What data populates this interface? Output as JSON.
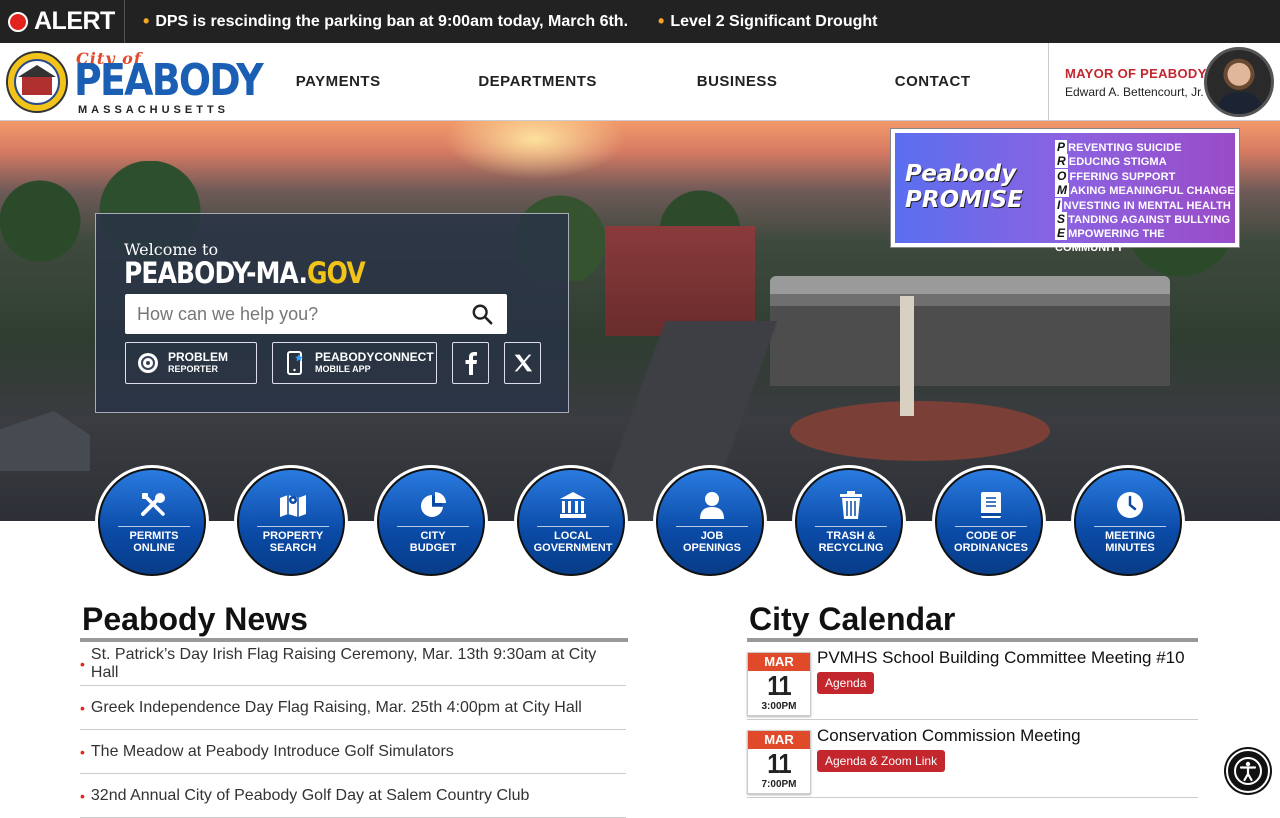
{
  "alert": {
    "label": "ALERT",
    "items": [
      "DPS is rescinding the parking ban at 9:00am today, March 6th.",
      "Level 2 Significant Drought"
    ]
  },
  "logo": {
    "city": "City of",
    "name": "PEABODY",
    "state": "MASSACHUSETTS"
  },
  "nav": {
    "items": [
      "PAYMENTS",
      "DEPARTMENTS",
      "BUSINESS",
      "CONTACT"
    ]
  },
  "mayor": {
    "title": "MAYOR OF PEABODY",
    "name": "Edward A. Bettencourt, Jr."
  },
  "welcome": {
    "to": "Welcome to",
    "site_main": "PEABODY-MA.",
    "site_accent": "GOV",
    "search_placeholder": "How can we help you?",
    "problem_line1": "PROBLEM",
    "problem_line2": "REPORTER",
    "connect_line1": "PEABODYCONNECT",
    "connect_line2": "MOBILE APP"
  },
  "promise": {
    "title1": "Peabody",
    "title2": "PROMISE",
    "lines": [
      {
        "letter": "P",
        "rest": "REVENTING SUICIDE"
      },
      {
        "letter": "R",
        "rest": "EDUCING STIGMA"
      },
      {
        "letter": "O",
        "rest": "FFERING SUPPORT"
      },
      {
        "letter": "M",
        "rest": "AKING MEANINGFUL CHANGE"
      },
      {
        "letter": "I",
        "rest": "NVESTING IN MENTAL HEALTH"
      },
      {
        "letter": "S",
        "rest": "TANDING AGAINST BULLYING"
      },
      {
        "letter": "E",
        "rest": "MPOWERING THE COMMUNITY"
      }
    ]
  },
  "quick_links": [
    {
      "l1": "PERMITS",
      "l2": "ONLINE",
      "icon": "tools-icon"
    },
    {
      "l1": "PROPERTY",
      "l2": "SEARCH",
      "icon": "map-icon"
    },
    {
      "l1": "CITY",
      "l2": "BUDGET",
      "icon": "pie-chart-icon"
    },
    {
      "l1": "LOCAL",
      "l2": "GOVERNMENT",
      "icon": "government-building-icon"
    },
    {
      "l1": "JOB",
      "l2": "OPENINGS",
      "icon": "person-icon"
    },
    {
      "l1": "TRASH &",
      "l2": "RECYCLING",
      "icon": "trash-icon"
    },
    {
      "l1": "CODE OF",
      "l2": "ORDINANCES",
      "icon": "book-icon"
    },
    {
      "l1": "MEETING",
      "l2": "MINUTES",
      "icon": "clock-icon"
    }
  ],
  "news": {
    "title": "Peabody News",
    "items": [
      "St. Patrick’s Day Irish Flag Raising Ceremony, Mar. 13th 9:30am at City Hall",
      "Greek Independence Day Flag Raising, Mar. 25th 4:00pm at City Hall",
      "The Meadow at Peabody Introduce Golf Simulators",
      "32nd Annual City of Peabody Golf Day at Salem Country Club"
    ]
  },
  "calendar": {
    "title": "City Calendar",
    "events": [
      {
        "month": "MAR",
        "day": "11",
        "time": "3:00PM",
        "title": "PVMHS School Building Committee Meeting #10",
        "tag": "Agenda"
      },
      {
        "month": "MAR",
        "day": "11",
        "time": "7:00PM",
        "title": "Conservation Commission Meeting",
        "tag": "Agenda & Zoom Link"
      }
    ]
  },
  "colors": {
    "alert_red": "#e3231d",
    "brand_blue": "#1a5fb4",
    "accent_gold": "#f2c41a",
    "tag_red": "#c4262e"
  }
}
